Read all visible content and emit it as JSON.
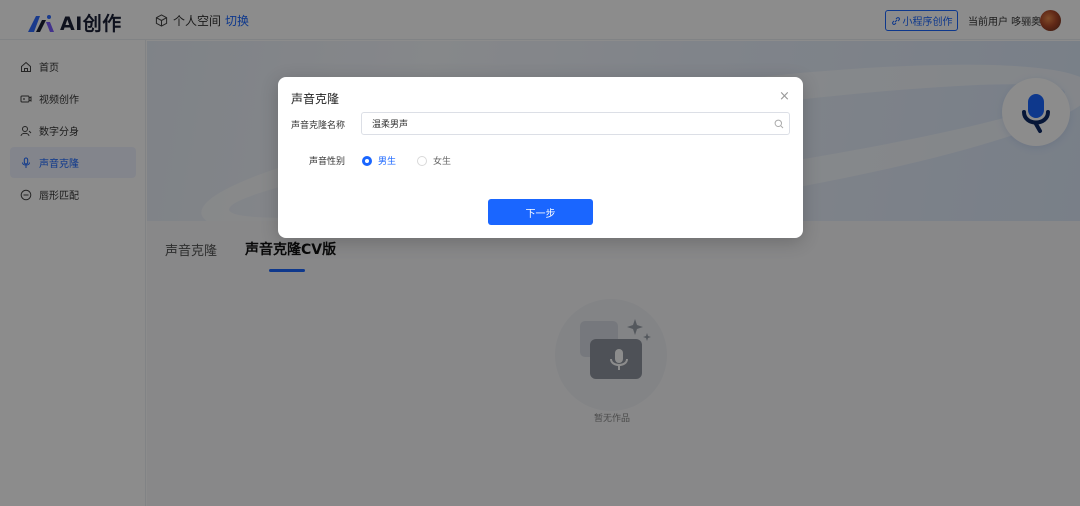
{
  "header": {
    "logo_text": "AI创作",
    "space_label": "个人空间",
    "switch_label": "切换",
    "mini_program_label": "小程序创作",
    "user_label": "当前用户 哆骊奥"
  },
  "sidebar": {
    "items": [
      {
        "label": "首页",
        "icon": "home-icon"
      },
      {
        "label": "视频创作",
        "icon": "video-icon"
      },
      {
        "label": "数字分身",
        "icon": "person-icon"
      },
      {
        "label": "声音克隆",
        "icon": "mic-icon",
        "active": true
      },
      {
        "label": "唇形匹配",
        "icon": "lip-icon"
      }
    ]
  },
  "main": {
    "tabs": [
      "声音克隆",
      "声音克隆CV版"
    ],
    "active_tab": "声音克隆CV版",
    "empty_text": "暂无作品"
  },
  "modal": {
    "title": "声音克隆",
    "close_label": "×",
    "name_label": "声音克隆名称",
    "name_value": "温柔男声",
    "gender_label": "声音性别",
    "gender_options": [
      "男生",
      "女生"
    ],
    "gender_selected": "男生",
    "next_label": "下一步"
  },
  "colors": {
    "accent": "#1a66ff",
    "overlay": "rgba(0,0,0,0.45)"
  }
}
